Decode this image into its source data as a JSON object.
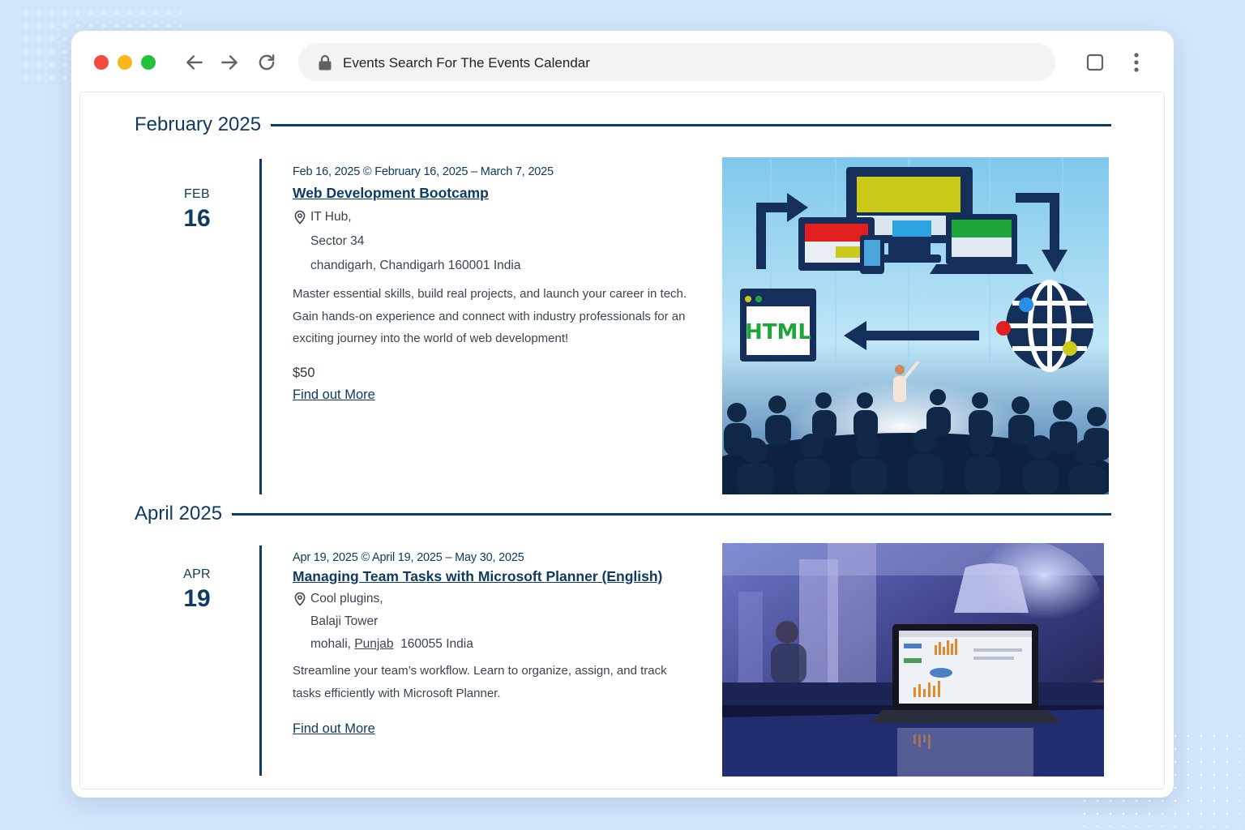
{
  "browser": {
    "url_title": "Events Search For The Events Calendar"
  },
  "months": [
    {
      "label": "February 2025"
    },
    {
      "label": "April 2025"
    }
  ],
  "events": [
    {
      "month_abbr": "FEB",
      "day": "16",
      "date_line": "Feb 16, 2025 © February 16, 2025 – March 7, 2025",
      "title": "Web Development Bootcamp",
      "venue_name": "IT Hub,",
      "venue_street": "Sector 34",
      "venue_city": "chandigarh,",
      "venue_region": "Chandigarh",
      "venue_zip_country": "160001 India",
      "description_1": "Master essential skills, build real projects, and launch your career in tech.",
      "description_2": "Gain hands-on experience and connect with industry professionals for an",
      "description_3": "exciting journey into the world of web development!",
      "cost": "$50",
      "more_label": "Find out More",
      "image_text": "HTML"
    },
    {
      "month_abbr": "APR",
      "day": "19",
      "date_line": "Apr 19, 2025 © April 19, 2025 – May 30, 2025",
      "title": "Managing Team Tasks with Microsoft Planner (English)",
      "venue_name": "Cool plugins,",
      "venue_street": "Balaji Tower",
      "venue_city": "mohali,",
      "venue_region": "Punjab",
      "venue_zip_country": "160055 India",
      "description_1": "Streamline your team’s workflow. Learn to organize, assign, and track",
      "description_2": "tasks efficiently with Microsoft Planner.",
      "more_label": "Find out More"
    }
  ],
  "colors": {
    "accent": "#0f3a62",
    "background": "#d3e5fb"
  },
  "icons": [
    "back-arrow-icon",
    "forward-arrow-icon",
    "reload-icon",
    "lock-icon",
    "tab-icon",
    "kebab-menu-icon",
    "location-pin-icon"
  ]
}
